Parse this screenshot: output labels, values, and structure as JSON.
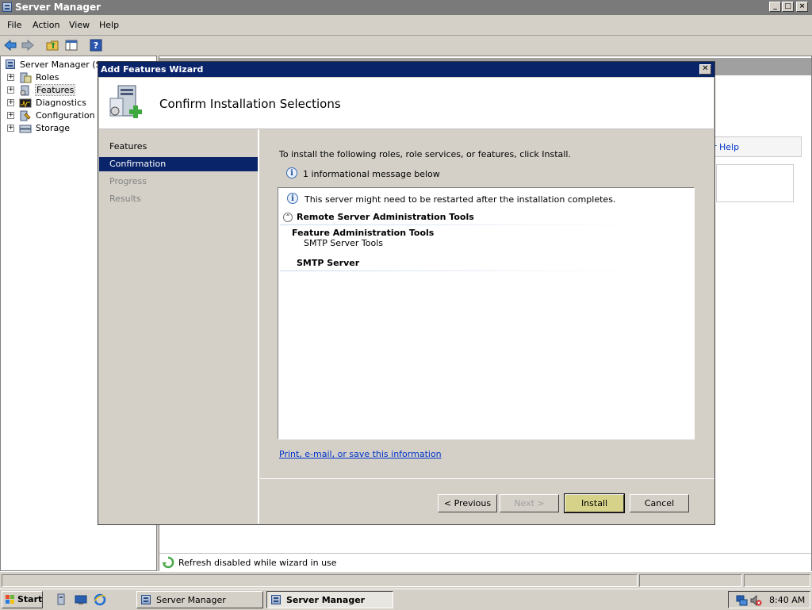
{
  "window": {
    "title": "Server Manager",
    "controls": {
      "minimize": "_",
      "maximize": "□",
      "close": "×"
    }
  },
  "menu": [
    "File",
    "Action",
    "View",
    "Help"
  ],
  "tree": {
    "root": "Server Manager (SR",
    "items": [
      "Roles",
      "Features",
      "Diagnostics",
      "Configuration",
      "Storage"
    ],
    "selected": "Features"
  },
  "right_panel": {
    "help_link": "r Help",
    "refresh_status": "Refresh disabled while wizard in use"
  },
  "dialog": {
    "title": "Add Features Wizard",
    "header": "Confirm Installation Selections",
    "nav": [
      "Features",
      "Confirmation",
      "Progress",
      "Results"
    ],
    "active_nav": "Confirmation",
    "intro": "To install the following roles, role services, or features, click Install.",
    "info_count": "1 informational message below",
    "list": {
      "message": "This server might need to be restarted after the installation completes.",
      "group": "Remote Server Administration Tools",
      "subgroup": "Feature Administration Tools",
      "subitem": "SMTP Server Tools",
      "item2": "SMTP Server"
    },
    "print_link": "Print, e-mail, or save this information",
    "buttons": {
      "previous": "< Previous",
      "next": "Next >",
      "install": "Install",
      "cancel": "Cancel"
    }
  },
  "taskbar": {
    "start": "Start",
    "tasks": [
      "Server Manager",
      "Server Manager"
    ],
    "clock": "8:40 AM"
  },
  "colors": {
    "dialog_title": "#0a246a",
    "nav_active": "#0a246a",
    "install_button": "#d6d28a",
    "link": "#0033cc"
  }
}
